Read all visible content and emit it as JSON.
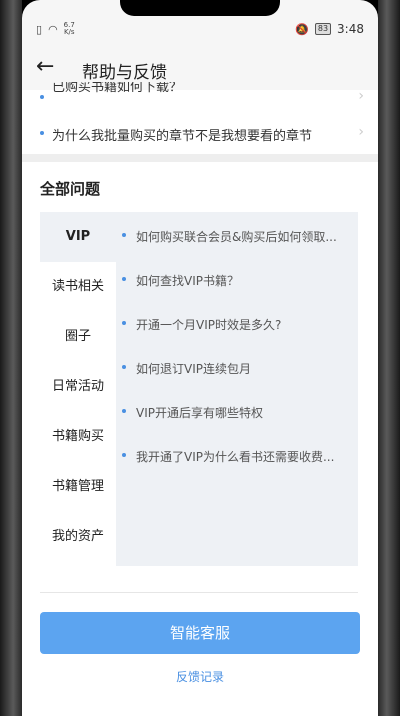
{
  "status_bar": {
    "speed_top": "6.7",
    "speed_bottom": "K/s",
    "battery": "83",
    "time": "3:48"
  },
  "header": {
    "title": "帮助与反馈"
  },
  "faq_top": [
    {
      "text": "已购买书籍如何下载？"
    },
    {
      "text": "为什么我批量购买的章节不是我想要看的章节"
    }
  ],
  "section": {
    "title": "全部问题"
  },
  "categories": [
    {
      "label": "VIP",
      "active": true
    },
    {
      "label": "读书相关"
    },
    {
      "label": "圈子"
    },
    {
      "label": "日常活动"
    },
    {
      "label": "书籍购买"
    },
    {
      "label": "书籍管理"
    },
    {
      "label": "我的资产"
    }
  ],
  "questions": [
    {
      "text": "如何购买联合会员&购买后如何领取..."
    },
    {
      "text": "如何查找VIP书籍？"
    },
    {
      "text": "开通一个月VIP时效是多久?"
    },
    {
      "text": "如何退订VIP连续包月"
    },
    {
      "text": "VIP开通后享有哪些特权"
    },
    {
      "text": "我开通了VIP为什么看书还需要收费..."
    }
  ],
  "actions": {
    "service_button": "智能客服",
    "feedback_link": "反馈记录"
  },
  "colors": {
    "accent": "#5ca4f0",
    "link": "#4a90e2"
  }
}
